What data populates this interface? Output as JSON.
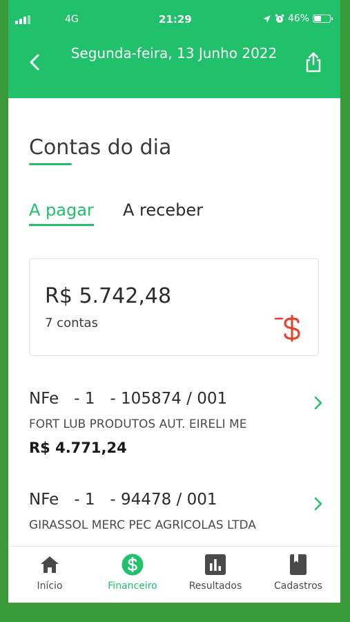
{
  "status_bar": {
    "network": "4G",
    "time": "21:29",
    "battery": "46%",
    "battery_level": 0.46
  },
  "header": {
    "title": "Segunda-feira, 13 Junho 2022",
    "back_icon": "chevron-left-icon",
    "share_icon": "share-icon"
  },
  "page": {
    "title": "Contas do dia"
  },
  "tabs": [
    {
      "label": "A pagar",
      "active": true
    },
    {
      "label": "A receber",
      "active": false
    }
  ],
  "summary": {
    "amount": "R$ 5.742,48",
    "count": "7 contas",
    "icon": "money-out-icon"
  },
  "entries": [
    {
      "doc": "NFe   - 1   - 105874 / 001",
      "name": "FORT LUB PRODUTOS AUT. EIRELI ME",
      "value": "R$ 4.771,24"
    },
    {
      "doc": "NFe   - 1   - 94478 / 001",
      "name": "GIRASSOL MERC PEC AGRICOLAS LTDA",
      "value": ""
    }
  ],
  "bottom_nav": [
    {
      "label": "Início",
      "icon": "home-icon",
      "active": false
    },
    {
      "label": "Financeiro",
      "icon": "dollar-icon",
      "active": true
    },
    {
      "label": "Resultados",
      "icon": "bar-chart-icon",
      "active": false
    },
    {
      "label": "Cadastros",
      "icon": "book-icon",
      "active": false
    }
  ],
  "colors": {
    "accent": "#21c16c",
    "negative": "#e2412c"
  }
}
